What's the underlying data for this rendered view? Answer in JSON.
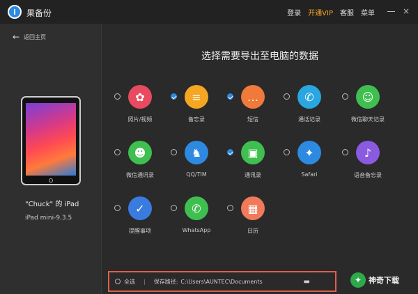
{
  "app": {
    "title": "果备份",
    "logo_letter": "i"
  },
  "top_menu": {
    "login": "登录",
    "vip": "开通VIP",
    "service": "客服",
    "menu": "菜单"
  },
  "window": {
    "close": "×"
  },
  "sidebar": {
    "back_label": "返回主页",
    "device_name": "\"Chuck\" 的 iPad",
    "device_model": "iPad mini-9.3.5"
  },
  "main": {
    "heading": "选择需要导出至电脑的数据",
    "items": [
      {
        "label": "照片/视频",
        "checked": false,
        "color": "#e84a60",
        "glyph": "✿"
      },
      {
        "label": "备忘录",
        "checked": true,
        "color": "#f5a623",
        "glyph": "≡"
      },
      {
        "label": "短信",
        "checked": true,
        "color": "#f07a3a",
        "glyph": "…"
      },
      {
        "label": "通话记录",
        "checked": false,
        "color": "#2aa7e0",
        "glyph": "✆"
      },
      {
        "label": "微信聊天记录",
        "checked": false,
        "color": "#3fbf4f",
        "glyph": "☺"
      },
      {
        "label": "微信通讯录",
        "checked": false,
        "color": "#3fbf4f",
        "glyph": "☻"
      },
      {
        "label": "QQ/TIM",
        "checked": false,
        "color": "#2d8ae0",
        "glyph": "♞"
      },
      {
        "label": "通讯录",
        "checked": true,
        "color": "#3fbf4f",
        "glyph": "▣"
      },
      {
        "label": "Safari",
        "checked": false,
        "color": "#2d8ae0",
        "glyph": "✦"
      },
      {
        "label": "语音备忘录",
        "checked": false,
        "color": "#8a5ae0",
        "glyph": "♪"
      },
      {
        "label": "提醒事项",
        "checked": false,
        "color": "#3a7be0",
        "glyph": "✓"
      },
      {
        "label": "WhatsApp",
        "checked": false,
        "color": "#3fbf4f",
        "glyph": "✆"
      },
      {
        "label": "日历",
        "checked": false,
        "color": "#f07a5a",
        "glyph": "▦"
      }
    ]
  },
  "bottom": {
    "select_all": "全选",
    "separator": "|",
    "save_path_label": "保存路径:",
    "save_path": "C:\\Users\\AUNTEC\\Documents",
    "folder_glyph": "▬"
  },
  "watermark": {
    "text": "神奇下载",
    "glyph": "✦"
  }
}
